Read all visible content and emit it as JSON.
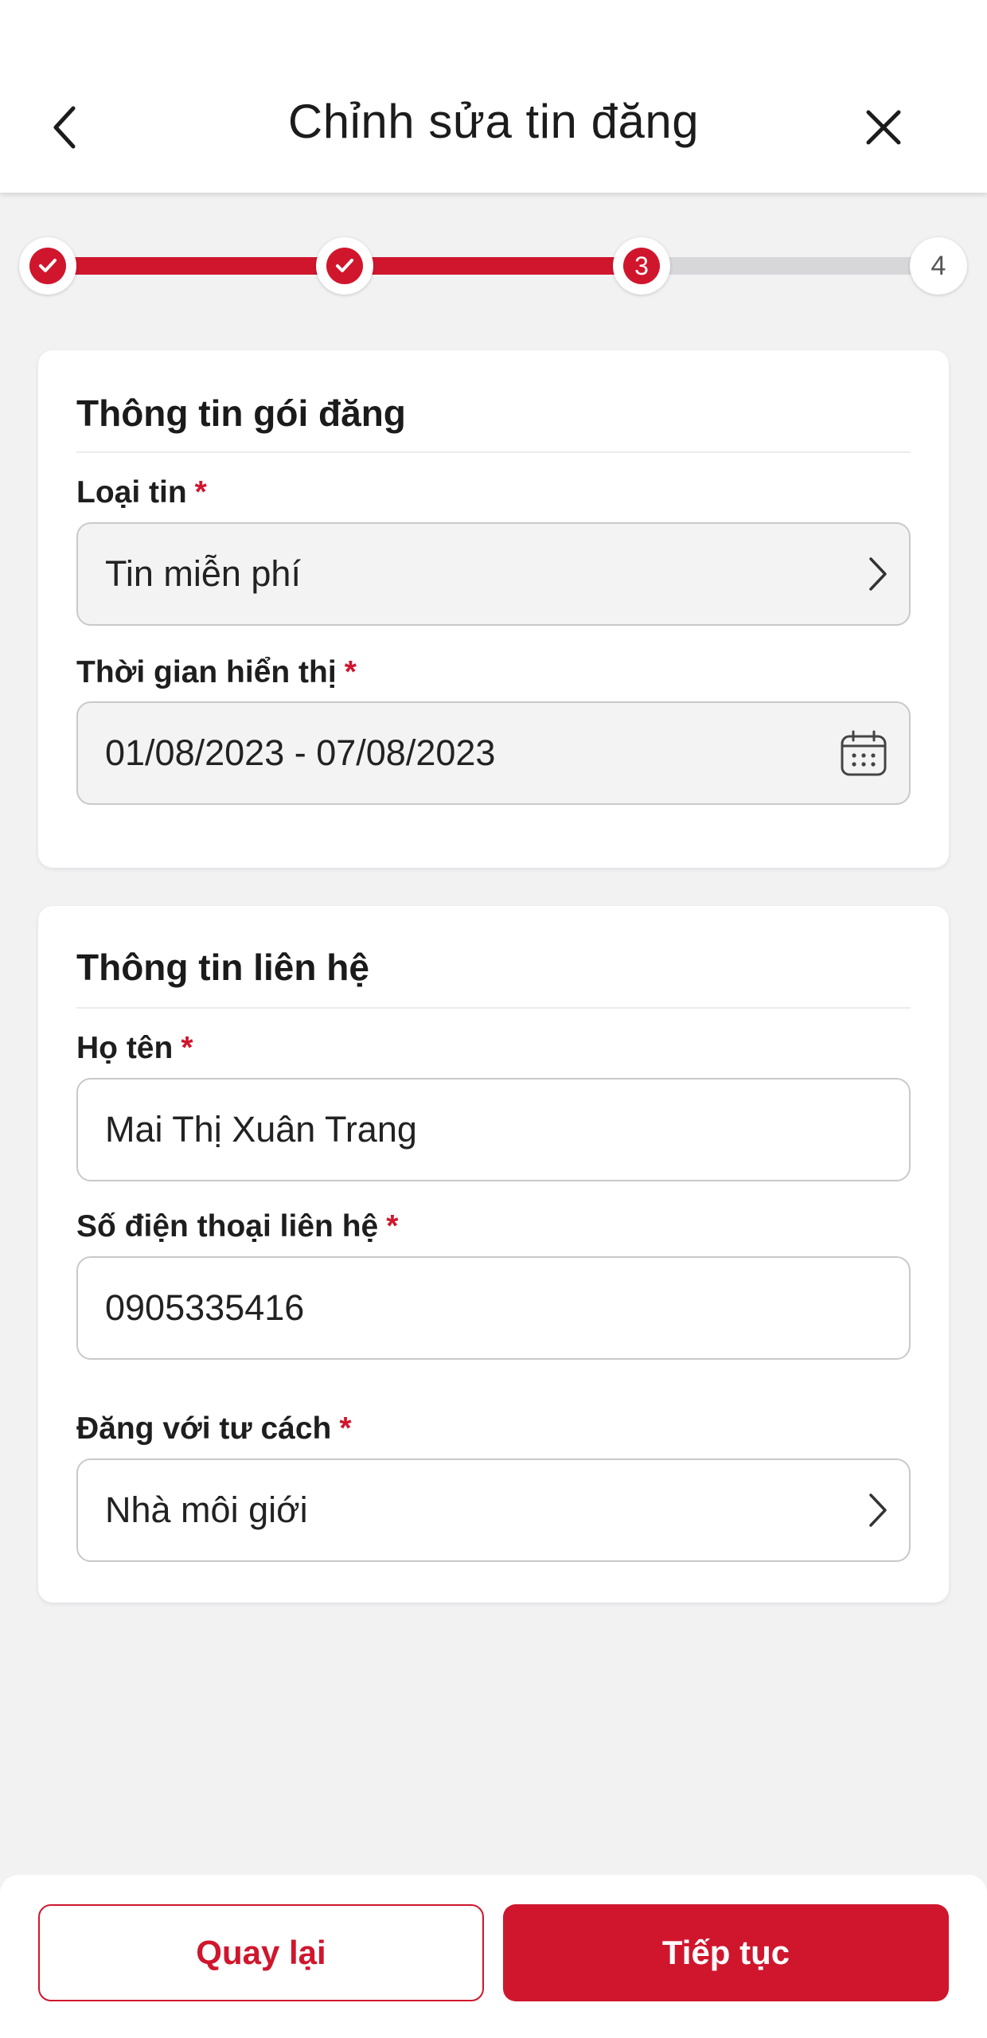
{
  "header": {
    "title": "Chỉnh sửa tin đăng"
  },
  "stepper": {
    "steps": [
      {
        "label": "",
        "state": "done"
      },
      {
        "label": "",
        "state": "done"
      },
      {
        "label": "3",
        "state": "active"
      },
      {
        "label": "4",
        "state": "pending"
      }
    ],
    "current_step": 3,
    "total_steps": 4
  },
  "package_card": {
    "title": "Thông tin gói đăng",
    "post_type": {
      "label": "Loại tin",
      "required_mark": "*",
      "value": "Tin miễn phí"
    },
    "display_time": {
      "label": "Thời gian hiển thị",
      "required_mark": "*",
      "value": "01/08/2023 - 07/08/2023"
    }
  },
  "contact_card": {
    "title": "Thông tin liên hệ",
    "full_name": {
      "label": "Họ tên",
      "required_mark": "*",
      "value": "Mai Thị Xuân Trang"
    },
    "phone": {
      "label": "Số điện thoại liên hệ",
      "required_mark": "*",
      "value": "0905335416"
    },
    "post_as": {
      "label": "Đăng với tư cách",
      "required_mark": "*",
      "value": "Nhà môi giới"
    }
  },
  "footer": {
    "back_label": "Quay lại",
    "next_label": "Tiếp tục"
  },
  "colors": {
    "accent": "#d0162d",
    "background": "#f2f2f3",
    "track_inactive": "#d7d7d9"
  },
  "icons": {
    "back": "chevron-left-icon",
    "close": "close-icon",
    "check": "check-icon",
    "chevron": "chevron-right-icon",
    "calendar": "calendar-icon"
  }
}
